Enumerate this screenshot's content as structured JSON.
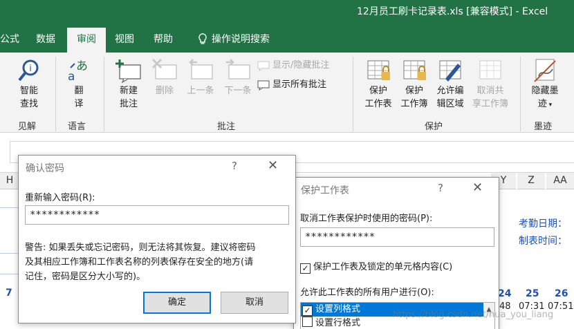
{
  "window": {
    "title": "12月员工刷卡记录表.xls  [兼容模式]  -  Excel"
  },
  "tabs": [
    {
      "label": "公式"
    },
    {
      "label": "数据"
    },
    {
      "label": "审阅"
    },
    {
      "label": "视图"
    },
    {
      "label": "帮助"
    },
    {
      "label": "操作说明搜索"
    }
  ],
  "ribbon": {
    "groups": {
      "insight": "见解",
      "language": "语言",
      "comments": "批注",
      "protect": "保护",
      "ink": "墨迹"
    },
    "buttons": {
      "smart_lookup_1": "智能",
      "smart_lookup_2": "查找",
      "translate_1": "翻",
      "translate_2": "译",
      "new_comment_1": "新建",
      "new_comment_2": "批注",
      "delete": "删除",
      "previous": "上一条",
      "next": "下一条",
      "show_hide_comment": "显示/隐藏批注",
      "show_all_comments": "显示所有批注",
      "protect_sheet_1": "保护",
      "protect_sheet_2": "工作表",
      "protect_workbook_1": "保护",
      "protect_workbook_2": "工作簿",
      "allow_edit_1": "允许编",
      "allow_edit_2": "辑区域",
      "unshare_1": "取消共",
      "unshare_2": "享工作簿",
      "hide_ink_1": "隐藏墨",
      "hide_ink_2": "迹"
    }
  },
  "sheet": {
    "columns": [
      "H",
      "Y",
      "Z",
      "AA"
    ],
    "attendance_date_label": "考勤日期：",
    "print_time_label": "制表时间：",
    "day_left": "7",
    "days": [
      "24",
      "25",
      "26"
    ],
    "times": [
      "48",
      "07:31",
      "07:51"
    ]
  },
  "confirm_dialog": {
    "title": "确认密码",
    "help": "?",
    "prompt": "重新输入密码(R):",
    "password_mask": "************",
    "warning_line1": "警告: 如果丢失或忘记密码，则无法将其恢复。建议将密码",
    "warning_line2": "及其相应工作簿和工作表名称的列表保存在安全的地方(请",
    "warning_line3": "记住，密码是区分大小写的)。",
    "ok": "确定",
    "cancel": "取消"
  },
  "protect_dialog": {
    "title": "保护工作表",
    "help": "?",
    "password_prompt": "取消工作表保护时使用的密码(P):",
    "password_mask": "************",
    "protect_checkbox_label": "保护工作表及锁定的单元格内容(C)",
    "protect_checked": true,
    "allow_label": "允许此工作表的所有用户进行(O):",
    "options": [
      {
        "label": "设置列格式",
        "checked": true
      },
      {
        "label": "设置行格式",
        "checked": false
      }
    ]
  },
  "watermark": "https://blog.csdn.net/hua_you_liang",
  "colors": {
    "excel_green": "#217346",
    "selection_blue": "#0078d7"
  }
}
